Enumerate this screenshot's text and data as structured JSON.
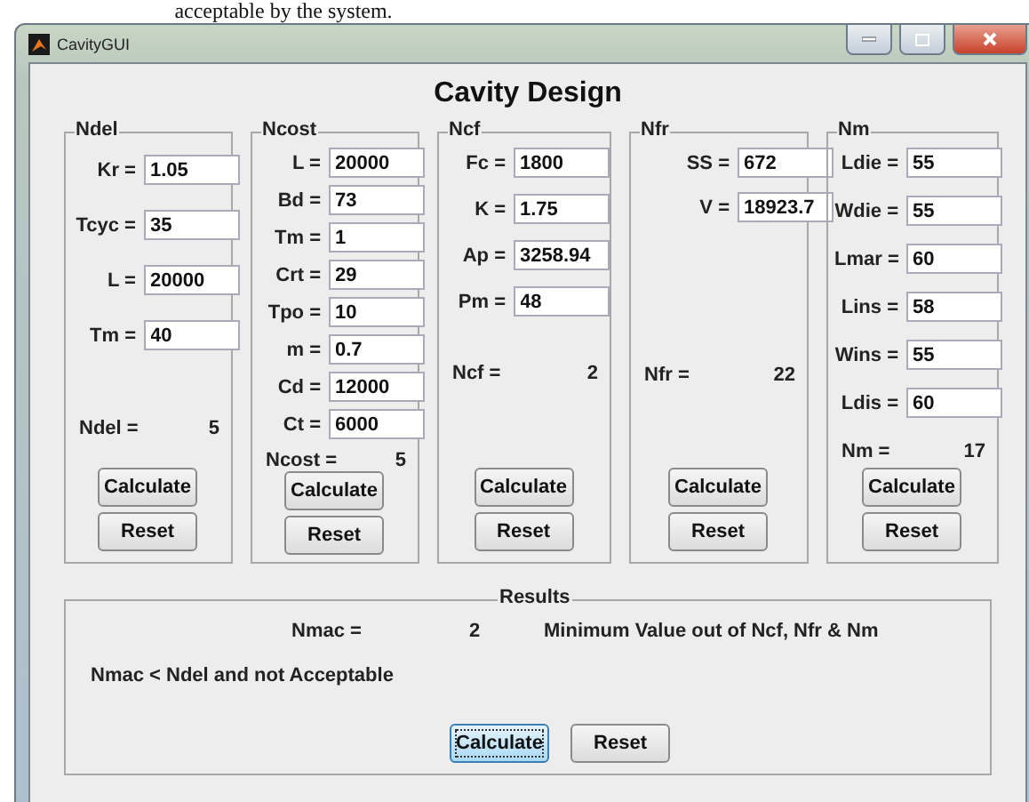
{
  "document_text": "acceptable by the system.",
  "window": {
    "title": "CavityGUI"
  },
  "heading": "Cavity Design",
  "panels": [
    {
      "title": "Ndel",
      "fields": [
        {
          "label": "Kr =",
          "value": "1.05"
        },
        {
          "label": "Tcyc =",
          "value": "35"
        },
        {
          "label": "L =",
          "value": "20000"
        },
        {
          "label": "Tm =",
          "value": "40"
        }
      ],
      "result": {
        "label": "Ndel =",
        "value": "5"
      },
      "buttons": [
        "Calculate",
        "Reset"
      ]
    },
    {
      "title": "Ncost",
      "fields": [
        {
          "label": "L =",
          "value": "20000"
        },
        {
          "label": "Bd =",
          "value": "73"
        },
        {
          "label": "Tm =",
          "value": "1"
        },
        {
          "label": "Crt =",
          "value": "29"
        },
        {
          "label": "Tpo =",
          "value": "10"
        },
        {
          "label": "m =",
          "value": "0.7"
        },
        {
          "label": "Cd =",
          "value": "12000"
        },
        {
          "label": "Ct =",
          "value": "6000"
        }
      ],
      "result": {
        "label": "Ncost =",
        "value": "5"
      },
      "buttons": [
        "Calculate",
        "Reset"
      ]
    },
    {
      "title": "Ncf",
      "fields": [
        {
          "label": "Fc =",
          "value": "1800"
        },
        {
          "label": "K =",
          "value": "1.75"
        },
        {
          "label": "Ap =",
          "value": "3258.94"
        },
        {
          "label": "Pm =",
          "value": "48"
        }
      ],
      "result": {
        "label": "Ncf =",
        "value": "2"
      },
      "buttons": [
        "Calculate",
        "Reset"
      ]
    },
    {
      "title": "Nfr",
      "fields": [
        {
          "label": "SS =",
          "value": "672"
        },
        {
          "label": "V =",
          "value": "18923.7"
        }
      ],
      "result": {
        "label": "Nfr =",
        "value": "22"
      },
      "buttons": [
        "Calculate",
        "Reset"
      ]
    },
    {
      "title": "Nm",
      "fields": [
        {
          "label": "Ldie =",
          "value": "55"
        },
        {
          "label": "Wdie =",
          "value": "55"
        },
        {
          "label": "Lmar =",
          "value": "60"
        },
        {
          "label": "Lins =",
          "value": "58"
        },
        {
          "label": "Wins =",
          "value": "55"
        },
        {
          "label": "Ldis =",
          "value": "60"
        }
      ],
      "result": {
        "label": "Nm =",
        "value": "17"
      },
      "buttons": [
        "Calculate",
        "Reset"
      ]
    }
  ],
  "results": {
    "title": "Results",
    "label": "Nmac =",
    "value": "2",
    "note": "Minimum Value out of Ncf, Nfr & Nm",
    "message": "Nmac < Ndel and not Acceptable",
    "buttons": [
      {
        "label": "Calculate",
        "focused": true
      },
      {
        "label": "Reset",
        "focused": false
      }
    ]
  }
}
